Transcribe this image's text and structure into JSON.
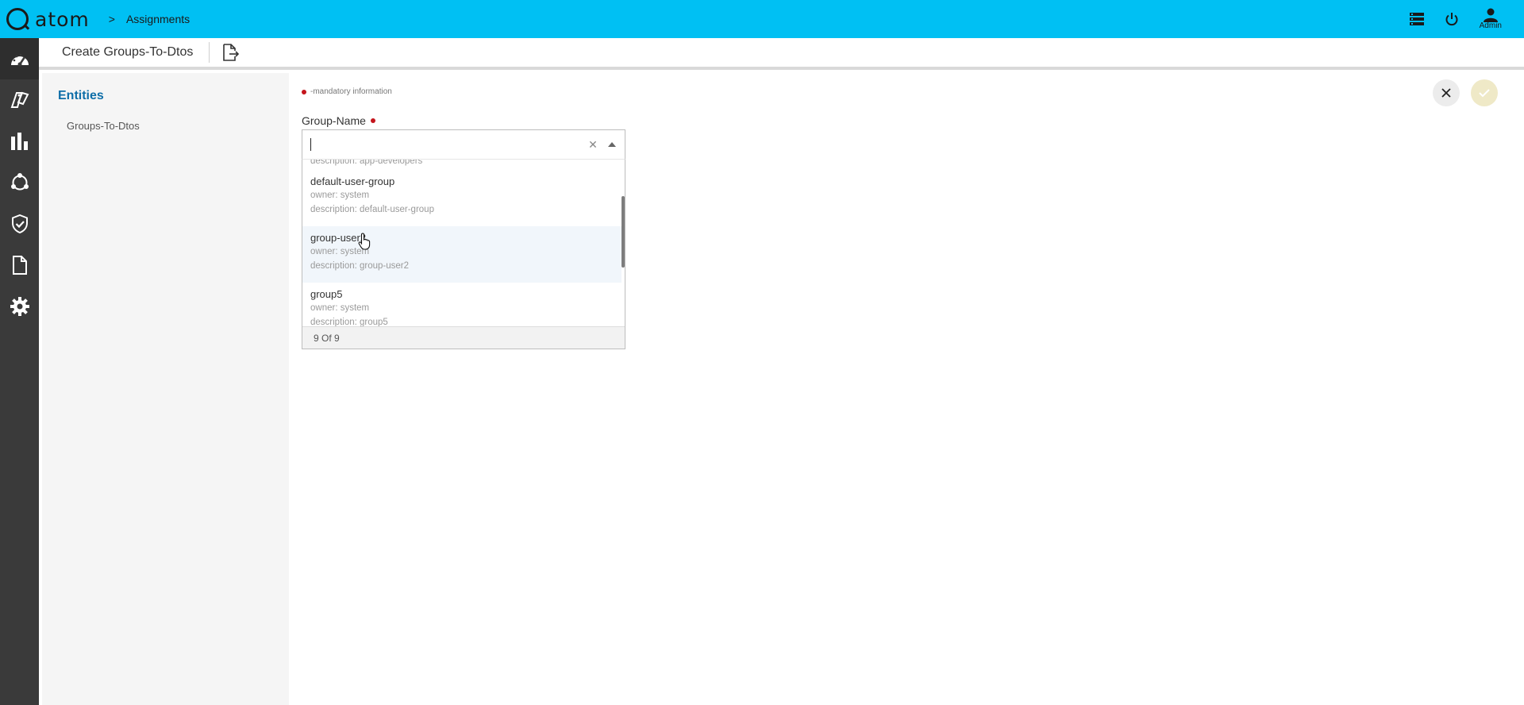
{
  "app": {
    "logo_text": "atom",
    "breadcrumb_separator": ">",
    "breadcrumb": "Assignments",
    "user_label": "Admin"
  },
  "topbar_icons": [
    "list-icon",
    "power-icon",
    "user-icon"
  ],
  "sidebar": {
    "items": [
      "dashboard-icon",
      "tags-icon",
      "bar-chart-icon",
      "network-icon",
      "shield-check-icon",
      "document-icon",
      "gear-icon"
    ]
  },
  "header": {
    "title": "Create Groups-To-Dtos"
  },
  "entities": {
    "title": "Entities",
    "items": [
      "Groups-To-Dtos"
    ]
  },
  "form": {
    "mandatory_note": "-mandatory information",
    "group_name_label": "Group-Name",
    "group_name_value": "",
    "options": [
      {
        "name": "",
        "owner": "",
        "description": "description: app-developers",
        "partial": true
      },
      {
        "name": "default-user-group",
        "owner": "owner: system",
        "description": "description: default-user-group"
      },
      {
        "name": "group-user2",
        "owner": "owner: system",
        "description": "description: group-user2",
        "hover": true
      },
      {
        "name": "group5",
        "owner": "owner: system",
        "description": "description: group5"
      }
    ],
    "footer": "9 Of 9"
  },
  "colors": {
    "topbar": "#00c0f3",
    "sidebar": "#3a3a3a",
    "accent": "#0e6ea8",
    "required": "#c4151c"
  }
}
